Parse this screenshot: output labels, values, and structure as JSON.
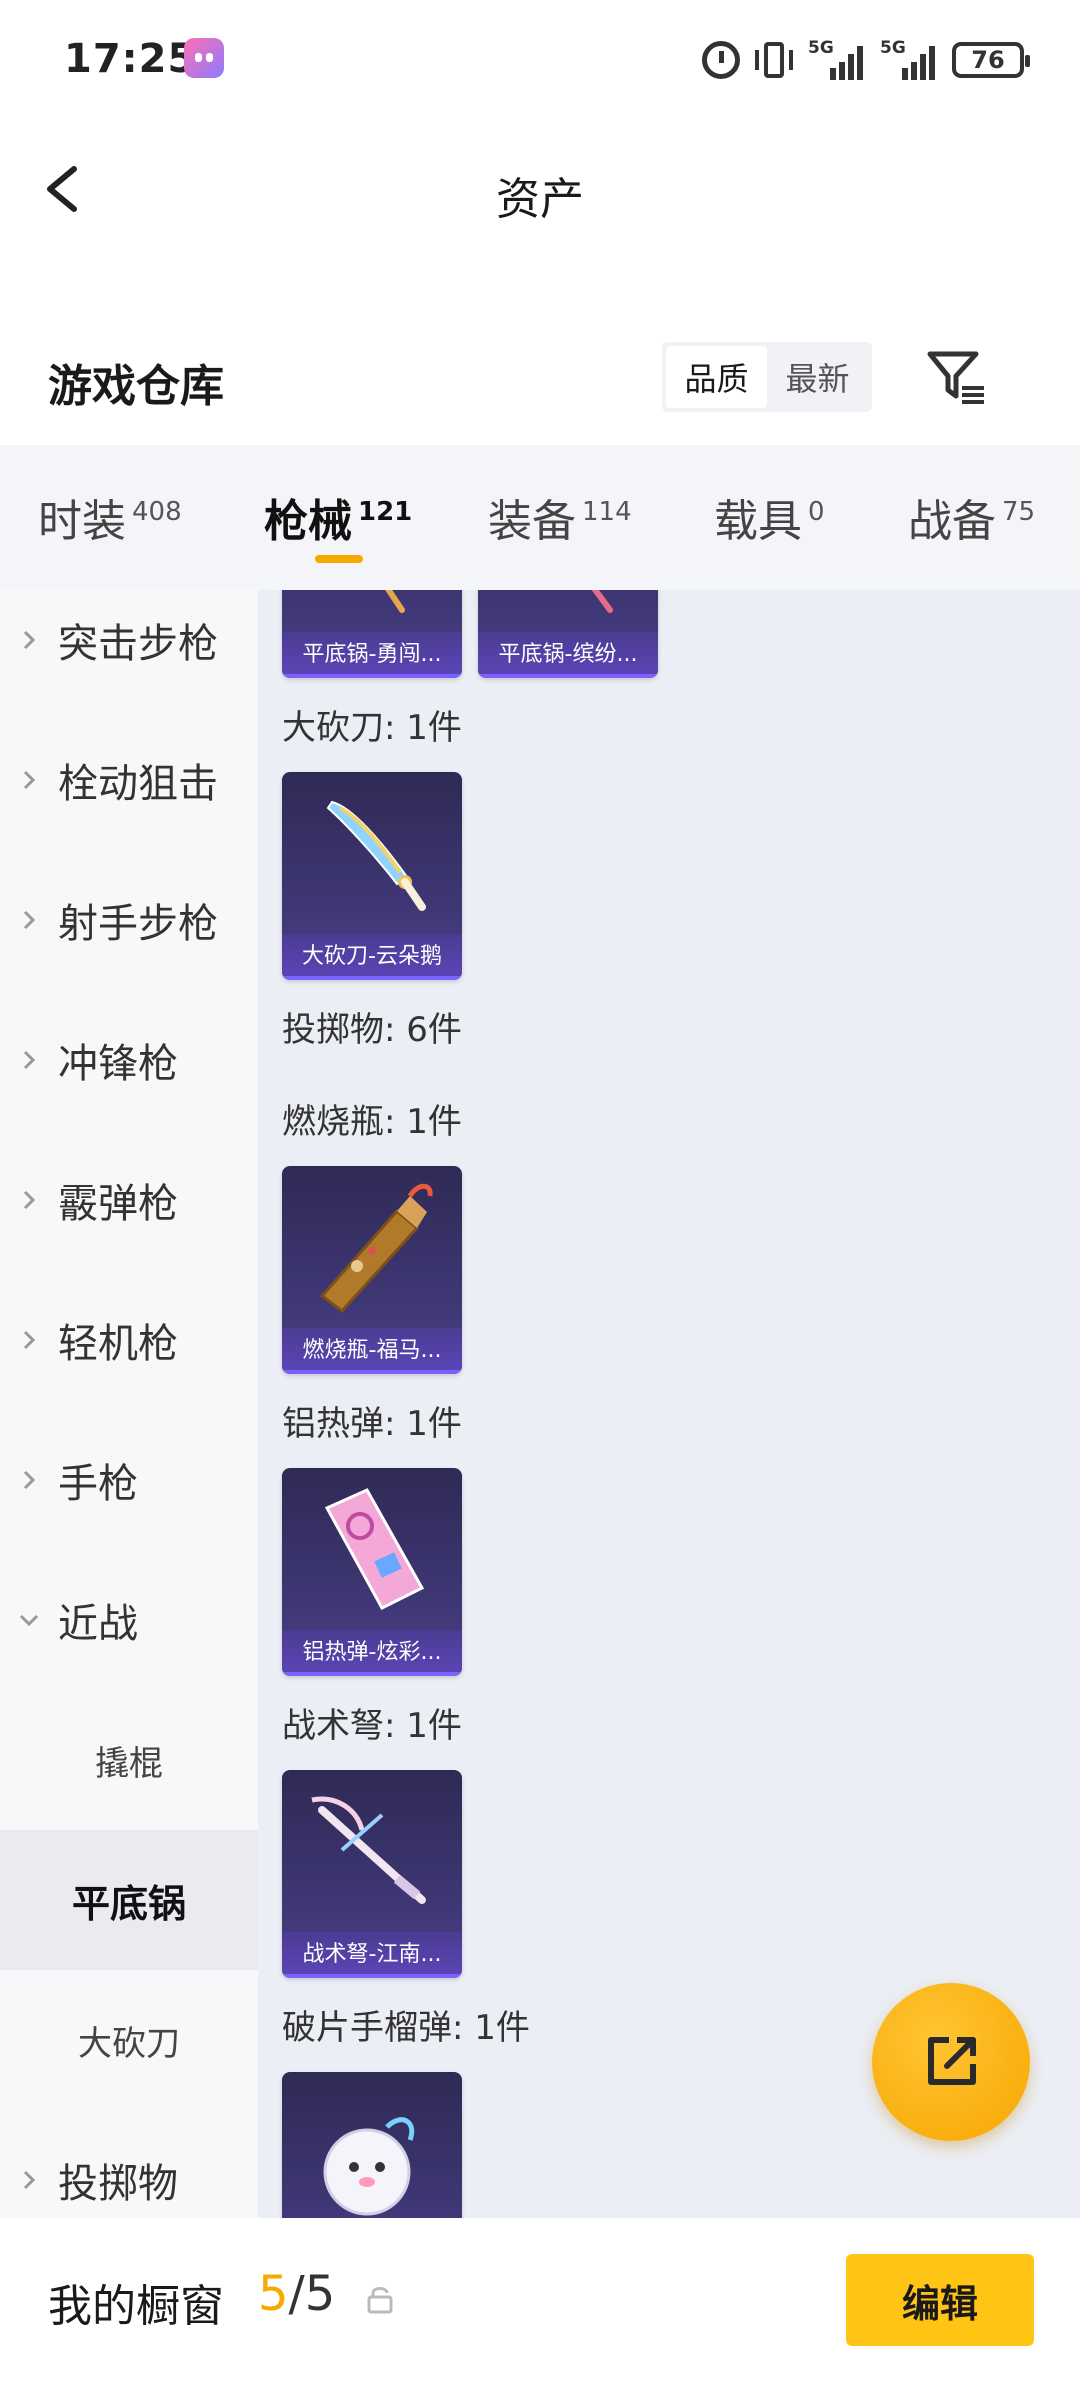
{
  "status_bar": {
    "time": "17:25",
    "net1": "5G",
    "net2": "5G",
    "battery": "76"
  },
  "nav": {
    "title": "资产"
  },
  "warehouse": {
    "title": "游戏仓库",
    "sort": [
      "品质",
      "最新"
    ]
  },
  "tabs": [
    {
      "label": "时装",
      "count": "408"
    },
    {
      "label": "枪械",
      "count": "121"
    },
    {
      "label": "装备",
      "count": "114"
    },
    {
      "label": "载具",
      "count": "0"
    },
    {
      "label": "战备",
      "count": "75"
    }
  ],
  "sidebar": {
    "items": [
      "突击步枪",
      "栓动狙击",
      "射手步枪",
      "冲锋枪",
      "霰弹枪",
      "轻机枪",
      "手枪",
      "近战"
    ],
    "subs": [
      "撬棍",
      "平底锅",
      "大砍刀"
    ],
    "last": "投掷物"
  },
  "content": {
    "top_cards": [
      "平底锅-勇闯...",
      "平底锅-缤纷..."
    ],
    "sections": [
      {
        "label": "大砍刀: 1件",
        "card": "大砍刀-云朵鹅"
      },
      {
        "label": "投掷物: 6件"
      },
      {
        "label": "燃烧瓶: 1件",
        "card": "燃烧瓶-福马..."
      },
      {
        "label": "铝热弹: 1件",
        "card": "铝热弹-炫彩..."
      },
      {
        "label": "战术弩: 1件",
        "card": "战术弩-江南..."
      },
      {
        "label": "破片手榴弹: 1件"
      }
    ]
  },
  "bottom": {
    "title": "我的橱窗",
    "current": "5",
    "total": "/5",
    "edit": "编辑"
  },
  "colors": {
    "accent": "#f6a900",
    "card_bg": "#3c3570",
    "content_bg": "#ebeef4"
  }
}
